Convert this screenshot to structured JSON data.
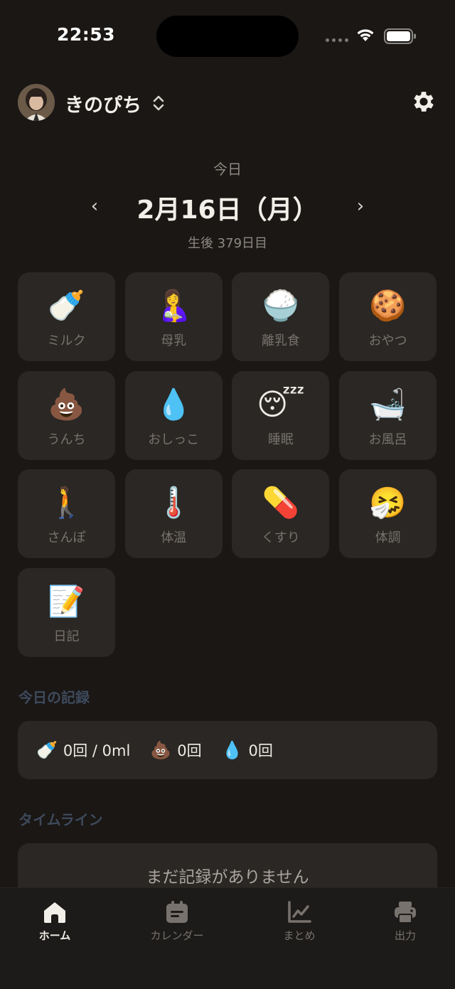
{
  "status_bar": {
    "time": "22:53"
  },
  "header": {
    "child_name": "きのぴち"
  },
  "date": {
    "label": "今日",
    "title": "2月16日（月）",
    "age": "生後 379日目",
    "prev": "‹",
    "next": "›"
  },
  "tiles": [
    {
      "emoji": "🍼",
      "label": "ミルク",
      "icon": "baby-bottle-icon"
    },
    {
      "emoji": "🤱",
      "label": "母乳",
      "icon": "breastfeeding-icon"
    },
    {
      "emoji": "🍚",
      "label": "離乳食",
      "icon": "rice-bowl-icon"
    },
    {
      "emoji": "🍪",
      "label": "おやつ",
      "icon": "cookie-icon"
    },
    {
      "emoji": "💩",
      "label": "うんち",
      "icon": "poop-icon"
    },
    {
      "emoji": "💧",
      "label": "おしっこ",
      "icon": "droplet-icon"
    },
    {
      "emoji": "😴",
      "label": "睡眠",
      "icon": "sleeping-face-icon"
    },
    {
      "emoji": "🛁",
      "label": "お風呂",
      "icon": "bathtub-icon"
    },
    {
      "emoji": "🚶",
      "label": "さんぽ",
      "icon": "walking-person-icon"
    },
    {
      "emoji": "🌡️",
      "label": "体温",
      "icon": "thermometer-icon"
    },
    {
      "emoji": "💊",
      "label": "くすり",
      "icon": "pill-icon"
    },
    {
      "emoji": "🤧",
      "label": "体調",
      "icon": "sneezing-face-icon"
    },
    {
      "emoji": "📝",
      "label": "日記",
      "icon": "memo-icon"
    }
  ],
  "today_records": {
    "title": "今日の記録",
    "milk": "0回 / 0ml",
    "poop": "0回",
    "pee": "0回"
  },
  "timeline": {
    "title": "タイムライン",
    "empty": "まだ記録がありません"
  },
  "tab_bar": {
    "home": "ホーム",
    "calendar": "カレンダー",
    "summary": "まとめ",
    "export": "出力"
  }
}
